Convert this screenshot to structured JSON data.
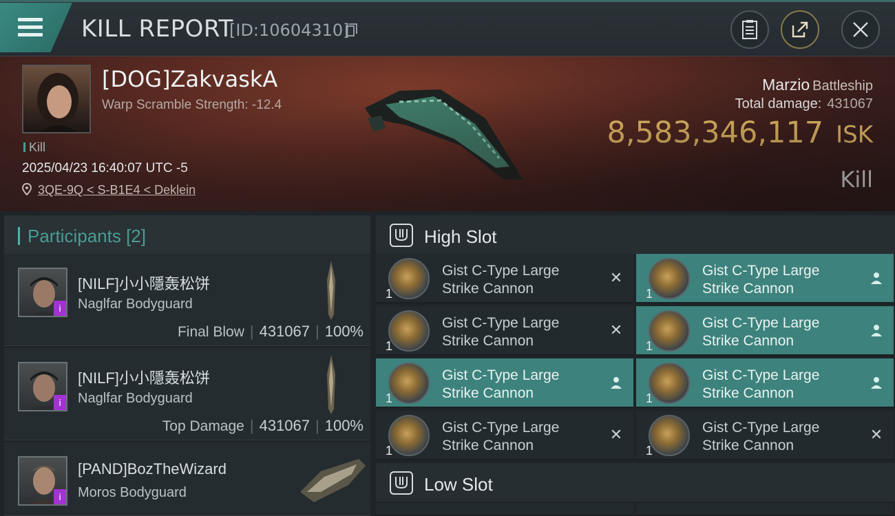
{
  "header": {
    "title": "KILL REPORT",
    "report_id": "[ID:10604310]"
  },
  "victim": {
    "name": "[DOG]ZakvaskA",
    "warp_scramble": "Warp Scramble Strength: -12.4",
    "tag": "Kill",
    "timestamp": "2025/04/23 16:40:07 UTC -5",
    "location": "3QE-9Q < S-B1E4 < Deklein",
    "ship_name": "Marzio",
    "ship_class": "Battleship",
    "total_damage_label": "Total damage:",
    "total_damage_value": "431067",
    "isk_value": "8,583,346,117",
    "isk_unit": "ISK",
    "result": "Kill"
  },
  "participants": {
    "title": "Participants [2]",
    "items": [
      {
        "name": "[NILF]小小隱轰松饼",
        "ship": "Naglfar Bodyguard",
        "badge": "i",
        "label": "Final Blow",
        "damage": "431067",
        "percent": "100%"
      },
      {
        "name": "[NILF]小小隱轰松饼",
        "ship": "Naglfar Bodyguard",
        "badge": "i",
        "label": "Top Damage",
        "damage": "431067",
        "percent": "100%"
      },
      {
        "name": "[PAND]BozTheWizard",
        "ship": "Moros Bodyguard",
        "badge": "i"
      }
    ]
  },
  "fitting": {
    "high_slot_title": "High Slot",
    "low_slot_title": "Low Slot",
    "high_slot": [
      {
        "line1": "Gist C-Type Large",
        "line2": "Strike Cannon",
        "qty": "1",
        "status": "destroyed"
      },
      {
        "line1": "Gist C-Type Large",
        "line2": "Strike Cannon",
        "qty": "1",
        "status": "dropped"
      },
      {
        "line1": "Gist C-Type Large",
        "line2": "Strike Cannon",
        "qty": "1",
        "status": "destroyed"
      },
      {
        "line1": "Gist C-Type Large",
        "line2": "Strike Cannon",
        "qty": "1",
        "status": "dropped"
      },
      {
        "line1": "Gist C-Type Large",
        "line2": "Strike Cannon",
        "qty": "1",
        "status": "dropped"
      },
      {
        "line1": "Gist C-Type Large",
        "line2": "Strike Cannon",
        "qty": "1",
        "status": "dropped"
      },
      {
        "line1": "Gist C-Type Large",
        "line2": "Strike Cannon",
        "qty": "1",
        "status": "destroyed"
      },
      {
        "line1": "Gist C-Type Large",
        "line2": "Strike Cannon",
        "qty": "1",
        "status": "destroyed"
      }
    ]
  },
  "colors": {
    "accent_teal": "#3d827c",
    "isk_gold": "#f0c46a",
    "badge_purple": "#a332d3"
  }
}
